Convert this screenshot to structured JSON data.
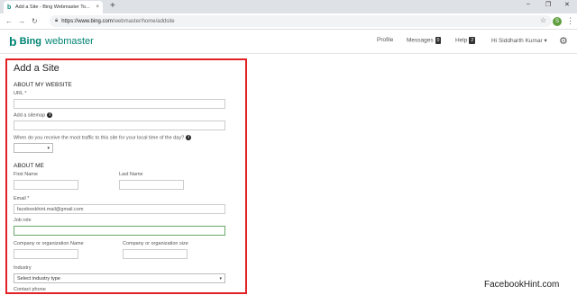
{
  "browser": {
    "tab_title": "Add a Site - Bing Webmaster To...",
    "tab_favicon": "b",
    "tab_close": "×",
    "new_tab": "+",
    "window_controls": [
      "–",
      "❐",
      "✕"
    ],
    "url_prefix": "https://www.bing.com",
    "url_path": "/webmaster/home/addsite",
    "profile_initial": "S",
    "nav_icons": [
      "back-icon",
      "forward-icon",
      "reload-icon",
      "lock-icon",
      "star-icon",
      "menu-icon"
    ]
  },
  "header": {
    "logo_mark": "b",
    "logo_bing": "Bing",
    "logo_product": "webmaster",
    "nav": {
      "profile": "Profile",
      "messages": "Messages",
      "messages_count": "0",
      "help": "Help",
      "help_count": "2",
      "user": "Hi Siddharth Kumar ▾"
    }
  },
  "form": {
    "title": "Add a Site",
    "about_website": "ABOUT MY WEBSITE",
    "url_label": "URL *",
    "url_value": "",
    "sitemap_label": "Add a sitemap",
    "sitemap_value": "",
    "traffic_label": "When do you receive the most traffic to this site for your local time of the day?",
    "traffic_value": "",
    "about_me": "ABOUT ME",
    "first_name_label": "First Name",
    "last_name_label": "Last Name",
    "email_label": "Email *",
    "email_value": "facebookhint.mail@gmail.com",
    "job_role_label": "Job role",
    "company_label": "Company or organization Name",
    "company_size_label": "Company or organization size",
    "industry_label": "Industry",
    "industry_value": "Select industry type",
    "contact_phone_label": "Contact phone",
    "info_glyph": "i"
  },
  "watermark": "FacebookHint.com",
  "colors": {
    "bing_teal": "#008373",
    "highlight_border": "#e22127"
  }
}
